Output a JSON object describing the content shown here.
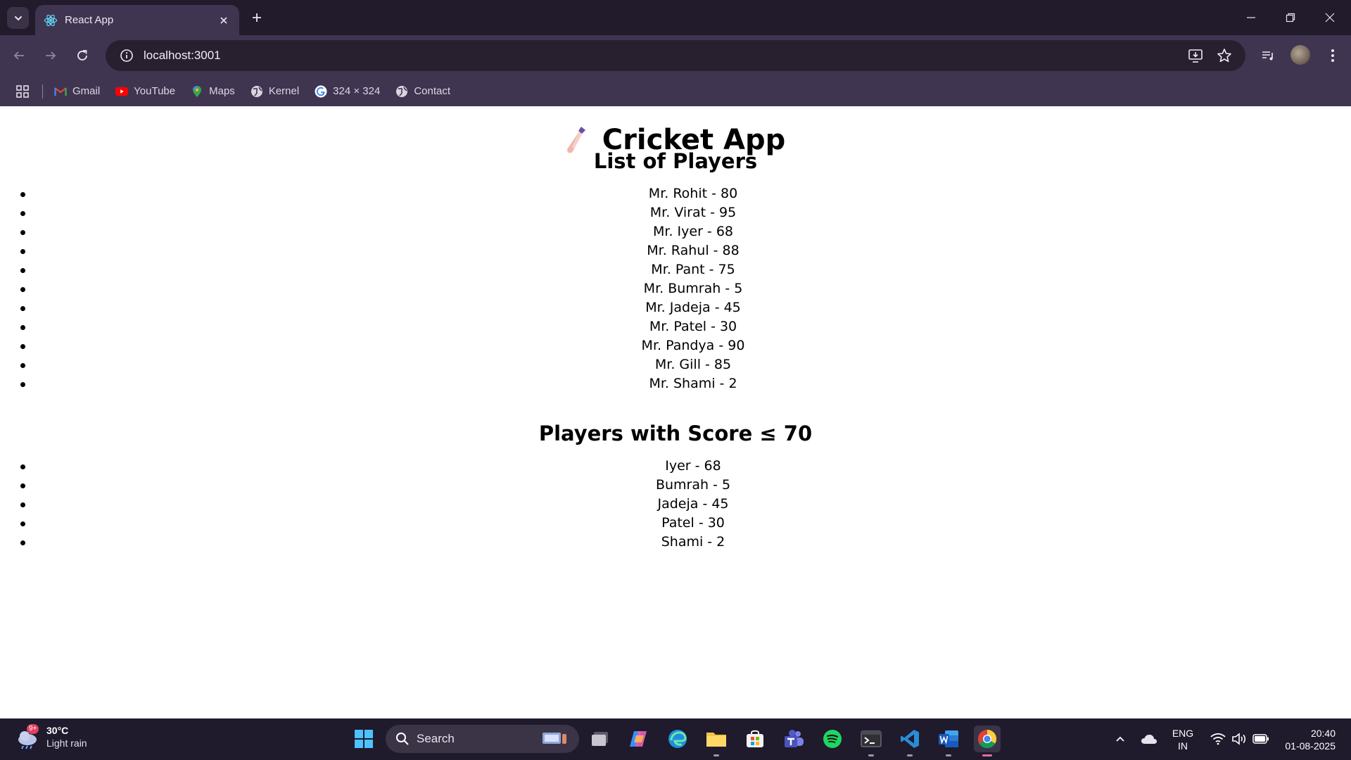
{
  "browser": {
    "tab_title": "React App",
    "url": "localhost:3001",
    "bookmarks": [
      {
        "label": "Gmail",
        "icon": "gmail-icon"
      },
      {
        "label": "YouTube",
        "icon": "youtube-icon"
      },
      {
        "label": "Maps",
        "icon": "maps-icon"
      },
      {
        "label": "Kernel",
        "icon": "globe-icon"
      },
      {
        "label": "324 × 324",
        "icon": "google-icon"
      },
      {
        "label": "Contact",
        "icon": "globe-icon"
      }
    ]
  },
  "page": {
    "title": "Cricket App",
    "list_heading": "List of Players",
    "players": [
      "Mr. Rohit - 80",
      "Mr. Virat - 95",
      "Mr. Iyer - 68",
      "Mr. Rahul - 88",
      "Mr. Pant - 75",
      "Mr. Bumrah - 5",
      "Mr. Jadeja - 45",
      "Mr. Patel - 30",
      "Mr. Pandya - 90",
      "Mr. Gill - 85",
      "Mr. Shami - 2"
    ],
    "filtered_heading": "Players with Score ≤ 70",
    "filtered_players": [
      "Iyer - 68",
      "Bumrah - 5",
      "Jadeja - 45",
      "Patel - 30",
      "Shami - 2"
    ]
  },
  "taskbar": {
    "weather_badge": "9+",
    "temperature": "30°C",
    "condition": "Light rain",
    "search_label": "Search",
    "language": "ENG",
    "region": "IN",
    "time": "20:40",
    "date": "01-08-2025"
  },
  "colors": {
    "tab_strip": "#221b2c",
    "toolbar": "#3f3550",
    "omnibox": "#28202f",
    "taskbar": "#1f1a2c"
  }
}
